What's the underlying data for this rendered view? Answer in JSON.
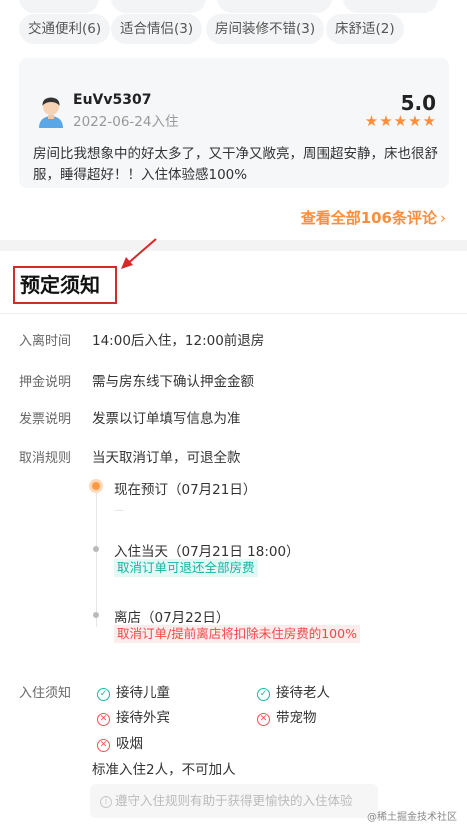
{
  "top_tags": {
    "row1_faint": [
      "",
      "",
      "",
      ""
    ],
    "row2": [
      "交通便利(6)",
      "适合情侣(3)",
      "房间装修不错(3)",
      "床舒适(2)"
    ]
  },
  "review": {
    "avatar_icon": "user-avatar-icon",
    "user": "EuVv5307",
    "date": "2022-06-24入住",
    "score": "5.0",
    "stars": "★★★★★",
    "text": "房间比我想象中的好太多了，又干净又敞亮，周围超安静，床也很舒服，睡得超好！！入住体验感100%"
  },
  "see_all": {
    "label": "查看全部106条评论",
    "chevron": "›"
  },
  "section": {
    "title": "预定须知"
  },
  "info": {
    "checkin_label": "入离时间",
    "checkin_value": "14:00后入住，12:00前退房",
    "deposit_label": "押金说明",
    "deposit_value": "需与房东线下确认押金金额",
    "invoice_label": "发票说明",
    "invoice_value": "发票以订单填写信息为准",
    "cancel_label": "取消规则",
    "cancel_value": "当天取消订单，可退全款"
  },
  "timeline": {
    "step1": "现在预订（07月21日）",
    "step1_dash": "—",
    "step2": "入住当天（07月21日 18:00）",
    "step2_note": "取消订单可退还全部房费",
    "step3": "离店（07月22日）",
    "step3_note": "取消订单/提前离店将扣除未住房费的100%"
  },
  "house_rules": {
    "label": "入住须知",
    "items": [
      {
        "text": "接待儿童",
        "allowed": true
      },
      {
        "text": "接待老人",
        "allowed": true
      },
      {
        "text": "接待外宾",
        "allowed": false
      },
      {
        "text": "带宠物",
        "allowed": false
      },
      {
        "text": "吸烟",
        "allowed": false
      }
    ],
    "note": "标准入住2人，不可加人",
    "tip": "遵守入住规则有助于获得更愉快的入住体验"
  },
  "colors": {
    "accent": "#ff8d3a",
    "highlight_box": "#d42a2a",
    "teal": "#13b5a3",
    "danger": "#f24848"
  },
  "watermark": "@稀土掘金技术社区"
}
